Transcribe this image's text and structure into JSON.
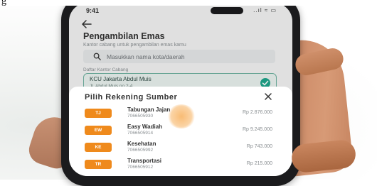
{
  "caption": {
    "text": "g"
  },
  "status_bar": {
    "time": "9:41",
    "icons": "..ıl ≈ ▭"
  },
  "header": {
    "title": "Pengambilan Emas",
    "subtitle": "Kantor cabang untuk pengambilan emas kamu"
  },
  "search": {
    "placeholder": "Masukkan nama kota/daerah"
  },
  "branch_section": {
    "label": "Daftar Kantor Cabang",
    "selected": {
      "name": "KCU Jakarta Abdul Muis",
      "address": "Jl. Abdul Muis no.2-4"
    }
  },
  "sheet": {
    "title": "Pilih Rekening Sumber",
    "accounts": [
      {
        "code": "TJ",
        "name": "Tabungan Jajan",
        "number": "7066505930",
        "balance": "Rp 2.876.000"
      },
      {
        "code": "EW",
        "name": "Easy Wadiah",
        "number": "7066505914",
        "balance": "Rp 9.245.000"
      },
      {
        "code": "KE",
        "name": "Kesehatan",
        "number": "7066505992",
        "balance": "Rp 743.000"
      },
      {
        "code": "TR",
        "name": "Transportasi",
        "number": "7066505912",
        "balance": "Rp 215.000"
      }
    ]
  },
  "colors": {
    "accent": "#ef8a1c",
    "selected_check": "#1fa58b",
    "selected_border": "#6fb2a1"
  }
}
